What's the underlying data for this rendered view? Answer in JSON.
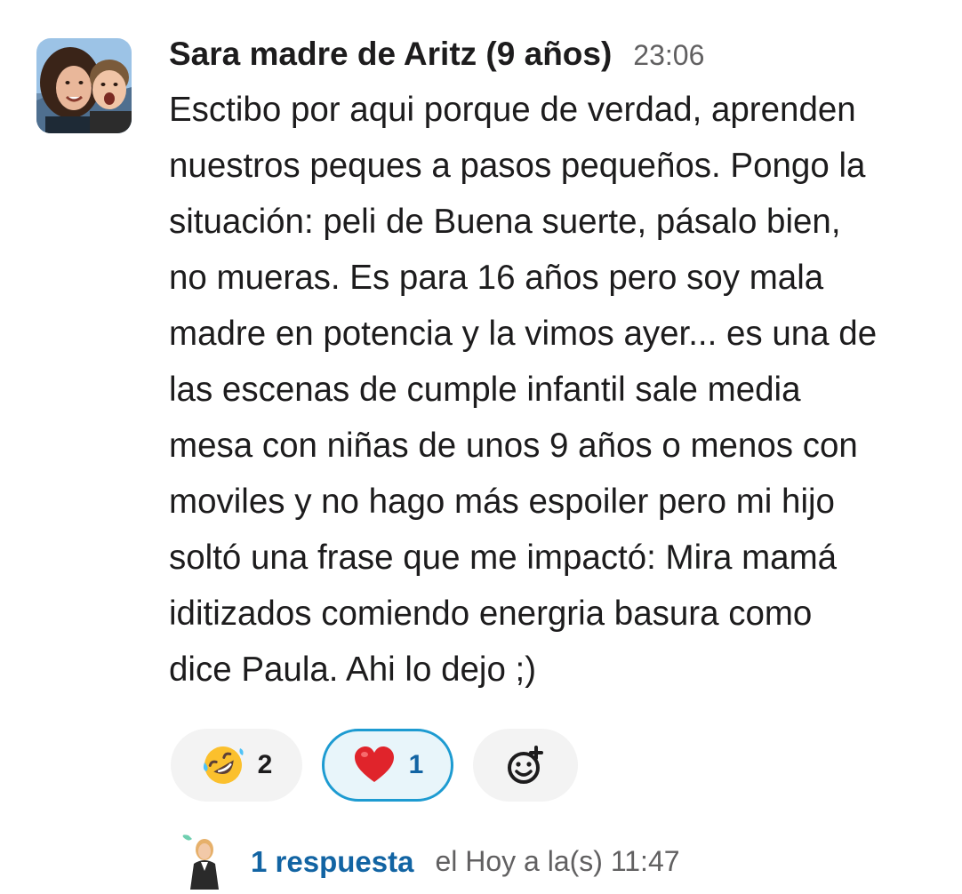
{
  "message": {
    "author": "Sara madre de Aritz (9 años)",
    "time": "23:06",
    "lines": [
      "Esctibo por aqui porque de verdad, aprenden",
      "nuestros peques a pasos pequeños.  Pongo la",
      "situación: peli de Buena suerte, pásalo bien,",
      "no mueras. Es para 16 años pero soy mala",
      "madre en potencia y la vimos ayer... es una de",
      "las escenas de cumple infantil sale media",
      "mesa con niñas de unos 9 años o menos con",
      "moviles y no hago más espoiler pero mi hijo",
      "soltó una frase que me impactó: Mira mamá",
      "iditizados comiendo energria basura como",
      "dice Paula. Ahi lo dejo ;)"
    ]
  },
  "reactions": [
    {
      "emoji_name": "rolling-on-floor-laughing-icon",
      "count": "2",
      "selected": false
    },
    {
      "emoji_name": "red-heart-icon",
      "count": "1",
      "selected": true
    }
  ],
  "add_reaction": {
    "icon": "add-reaction-icon"
  },
  "thread": {
    "reply_count": "1 respuesta",
    "last_reply": "el Hoy a la(s) 11:47"
  },
  "colors": {
    "text": "#1d1c1d",
    "muted": "#616061",
    "link": "#1264a3",
    "selected_border": "#1d9bd1",
    "selected_bg": "#e8f5fa",
    "reaction_bg": "#f3f3f3"
  }
}
